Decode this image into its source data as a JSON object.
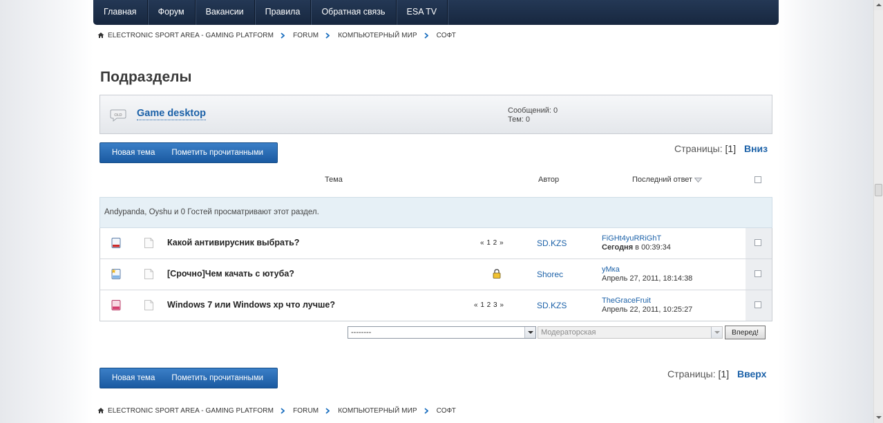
{
  "nav": {
    "items": [
      {
        "label": "Главная"
      },
      {
        "label": "Форум"
      },
      {
        "label": "Вакансии"
      },
      {
        "label": "Правила"
      },
      {
        "label": "Обратная связь"
      },
      {
        "label": "ESA TV"
      }
    ]
  },
  "breadcrumb": {
    "items": [
      "ELECTRONIC SPORT AREA - GAMING PLATFORM",
      "FORUM",
      "КОМПЬЮТЕРНЫЙ МИР",
      "СОФТ"
    ]
  },
  "subforums": {
    "title": "Подразделы",
    "items": [
      {
        "name": "Game desktop",
        "icon": "old-speech-bubble-icon",
        "posts": "Сообщений: 0",
        "topics": "Тем: 0"
      }
    ]
  },
  "actions": {
    "new_topic": "Новая тема",
    "mark_read": "Пометить прочитанными"
  },
  "pagination": {
    "label": "Страницы:",
    "current": "[1]",
    "down": "Вниз",
    "up": "Вверх"
  },
  "table": {
    "col_topic": "Тема",
    "col_author": "Автор",
    "col_last": "Последний ответ",
    "viewers": "Andypanda, Oyshu и 0 Гостей просматривают этот раздел.",
    "rows": [
      {
        "title": "Какой антивирусник выбрать?",
        "pages": "« 1 2 »",
        "author": "SD.KZS",
        "last_user": "FiGHt4yuRRiGhT",
        "last_date_bold": "Сегодня",
        "last_date": " в 00:39:34",
        "status_color": "#cc2a2a"
      },
      {
        "title": "[Срочно]Чем качать с ютуба?",
        "pages": "",
        "locked": true,
        "author": "Shorec",
        "last_user": "уМка",
        "last_date_bold": "",
        "last_date": "Апрель 27, 2011, 18:14:38",
        "status_color": "#3b8ad8"
      },
      {
        "title": "Windows 7 или Windows xp что лучше?",
        "pages": "« 1 2 3 »",
        "author": "SD.KZS",
        "last_user": "TheGraceFruit",
        "last_date_bold": "",
        "last_date": "Апрель 22, 2011, 10:25:27",
        "status_color": "#d43c6e"
      }
    ]
  },
  "moderation": {
    "select1_value": "--------",
    "select2_value": "Модераторская",
    "go_label": "Вперед!"
  }
}
